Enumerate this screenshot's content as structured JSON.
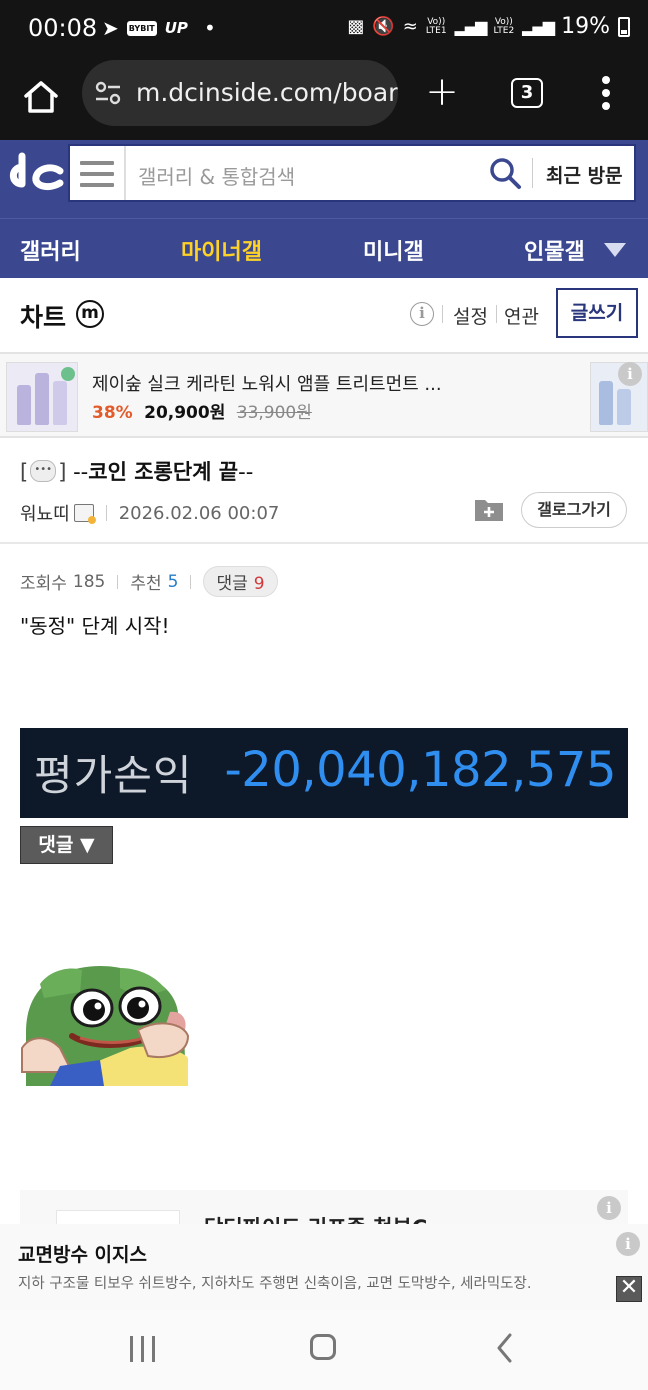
{
  "status_bar": {
    "time": "00:08",
    "app_label_bybit": "BYBIT",
    "app_label_up": "UP",
    "net1_top": "Vo))",
    "net1_bottom": "LTE1",
    "net2_top": "Vo))",
    "net2_bottom": "LTE2",
    "battery": "19%"
  },
  "browser": {
    "url": "m.dcinside.com/boar",
    "tab_count": "3"
  },
  "site_header": {
    "search_placeholder": "갤러리 & 통합검색",
    "recent_visits_label": "최근 방문"
  },
  "nav": {
    "items": [
      "갤러리",
      "마이너갤",
      "미니갤",
      "인물갤"
    ],
    "active_index": 1,
    "active_color": "#ffd227",
    "background_color": "#3b4890"
  },
  "gallery": {
    "name": "차트",
    "badge": "m",
    "settings_label": "설정",
    "related_label": "연관",
    "write_label": "글쓰기"
  },
  "top_ad": {
    "title": "제이숲 실크 케라틴 노워시 앰플 트리트먼트 ...",
    "discount": "38%",
    "price": "20,900원",
    "original_price": "33,900원"
  },
  "post": {
    "title_bracket_open": "[",
    "title_bracket_close": "]",
    "title_icon": "speech-bubble-icon",
    "title_prefix": "--",
    "title_main": "코인 조롱단계 끝",
    "title_suffix": "--",
    "author": "워뇨띠",
    "date": "2026.02.06 00:07",
    "blog_button": "갤로그가기",
    "views_label": "조회수",
    "views": "185",
    "recommend_label": "추천",
    "recommend": "5",
    "comments_label": "댓글",
    "comments": "9",
    "body_text": "\"동정\" 단계 시작!",
    "pnl_label": "평가손익",
    "pnl_value": "-20,040,182,575",
    "comment_toggle": "댓글 ▼"
  },
  "ad_card": {
    "title_partial": "닥터파이드 리프좀 청부C"
  },
  "bottom_ad": {
    "title": "교면방수 이지스",
    "description": "지하 구조물 티보우 쉬트방수, 지하차도 주행면 신축이음, 교면 도막방수, 세라믹도장.",
    "close_label": "✕"
  }
}
